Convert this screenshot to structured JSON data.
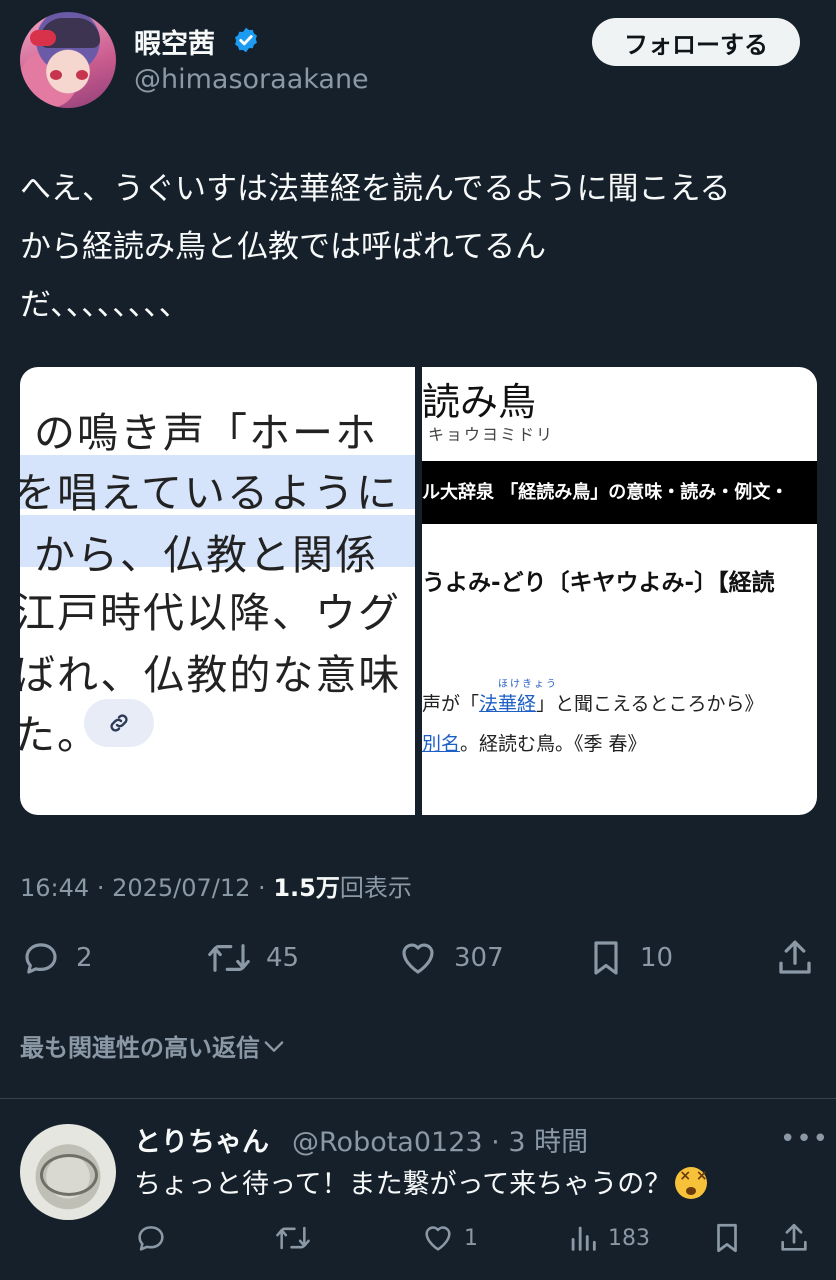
{
  "author": {
    "display_name": "暇空茜",
    "handle": "@himasoraakane",
    "verified": true
  },
  "follow_button": {
    "label": "フォローする"
  },
  "tweet": {
    "text": "へえ、うぐいすは法華経を読んでるように聞こえる\nから経読み鳥と仏教では呼ばれてるん\nだ、、、、、、、、"
  },
  "media_left": {
    "lines": [
      "の鳴き声「ホーホ",
      "を唱えているように",
      "から、仏教と関係",
      "江戸時代以降、ウグ",
      "ばれ、仏教的な意味",
      "た。"
    ]
  },
  "media_right": {
    "title": "読み鳥",
    "kana": "キョウヨミドリ",
    "bar": "ル大辞泉 「経読み鳥」の意味・読み・例文・",
    "headword": "うよみ-どり〔キヤウよみ-〕【経読",
    "ruby": "ほけきょう",
    "def1_pre": "声が「",
    "def1_link": "法華経",
    "def1_post": "」と聞こえるところから》",
    "def2_link": "別名",
    "def2_post": "。経読む鳥。《季 春》"
  },
  "meta": {
    "time": "16:44",
    "date": "2025/07/12",
    "views_count": "1.5万",
    "views_label": "回表示"
  },
  "actions": {
    "replies": "2",
    "retweets": "45",
    "likes": "307",
    "bookmarks": "10"
  },
  "replies_sort": {
    "label": "最も関連性の高い返信"
  },
  "reply": {
    "display_name": "とりちゃん",
    "handle_time": "@Robota0123 · 3 時間",
    "more": "•••",
    "text": "ちょっと待って！また繋がって来ちゃうの？",
    "likes": "1",
    "views": "183"
  },
  "colors": {
    "background": "#15202b",
    "text": "#f7f9f9",
    "secondary": "#8b98a5",
    "verified": "#1d9bf0"
  }
}
